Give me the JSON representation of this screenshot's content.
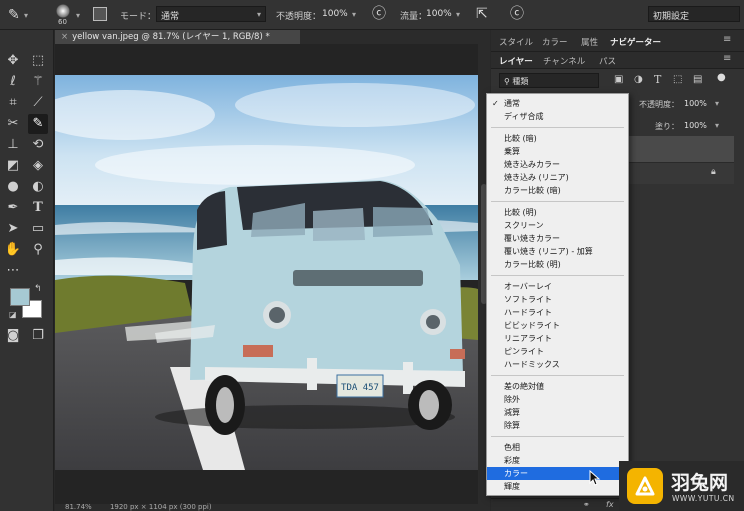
{
  "options_bar": {
    "brush_size": "60",
    "mode_label": "モード：",
    "mode_value": "通常",
    "opacity_label": "不透明度：",
    "opacity_value": "100%",
    "flow_label": "流量：",
    "flow_value": "100%",
    "workspace": "初期設定"
  },
  "document": {
    "tab_title": "yellow van.jpeg @ 81.7% (レイヤー 1, RGB/8) *",
    "tab_close": "×",
    "zoom": "81.74%",
    "dimensions": "1920 px × 1104 px (300 ppi)",
    "license_plate": "TDA 457"
  },
  "panels": {
    "top_tabs": [
      "スタイル",
      "カラー",
      "属性",
      "ナビゲーター"
    ],
    "layer_tabs": [
      "レイヤー",
      "チャンネル",
      "パス"
    ],
    "filter_kind": "種類",
    "opacity_label": "不透明度：",
    "opacity_value": "100%",
    "fill_label": "塗り：",
    "fill_value": "100%",
    "fx_label": "fx"
  },
  "blend_mode_menu": {
    "check": "✓",
    "groups": [
      [
        "通常",
        "ディザ合成"
      ],
      [
        "比較 (暗)",
        "乗算",
        "焼き込みカラー",
        "焼き込み (リニア)",
        "カラー比較 (暗)"
      ],
      [
        "比較 (明)",
        "スクリーン",
        "覆い焼きカラー",
        "覆い焼き (リニア) - 加算",
        "カラー比較 (明)"
      ],
      [
        "オーバーレイ",
        "ソフトライト",
        "ハードライト",
        "ビビッドライト",
        "リニアライト",
        "ピンライト",
        "ハードミックス"
      ],
      [
        "差の絶対値",
        "除外",
        "減算",
        "除算"
      ],
      [
        "色相",
        "彩度",
        "カラー",
        "輝度"
      ]
    ],
    "checked": "通常",
    "highlighted": "カラー"
  },
  "watermark": {
    "brand": "羽兔网",
    "url": "WWW.YUTU.CN"
  },
  "colors": {
    "foreground": "#a6c9d3",
    "background": "#ffffff",
    "menu_highlight": "#1f6ce0",
    "watermark_icon": "#f4b400"
  },
  "icons": {
    "tools": [
      "move-icon",
      "marquee-icon",
      "lasso-icon",
      "magic-wand-icon",
      "crop-icon",
      "eyedropper-icon",
      "healing-icon",
      "brush-icon",
      "stamp-icon",
      "history-brush-icon",
      "eraser-icon",
      "bucket-icon",
      "blur-icon",
      "dodge-icon",
      "pen-icon",
      "type-icon",
      "path-select-icon",
      "rectangle-icon",
      "hand-icon",
      "zoom-icon",
      "more-icon"
    ]
  }
}
